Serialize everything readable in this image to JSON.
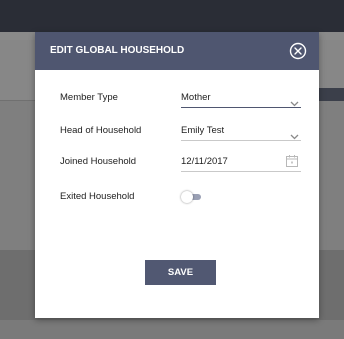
{
  "modal": {
    "title": "EDIT GLOBAL HOUSEHOLD",
    "close_icon": "close-circle-icon",
    "header_color": "#4f5670"
  },
  "form": {
    "member_type": {
      "label": "Member Type",
      "value": "Mother",
      "icon": "chevron-down-icon"
    },
    "head_of_household": {
      "label": "Head of Household",
      "value": "Emily Test",
      "icon": "chevron-down-icon"
    },
    "joined_household": {
      "label": "Joined Household",
      "value": "12/11/2017",
      "icon": "calendar-icon"
    },
    "exited_household": {
      "label": "Exited Household",
      "toggle_on": false
    }
  },
  "actions": {
    "save_label": "SAVE",
    "save_color": "#515872"
  }
}
